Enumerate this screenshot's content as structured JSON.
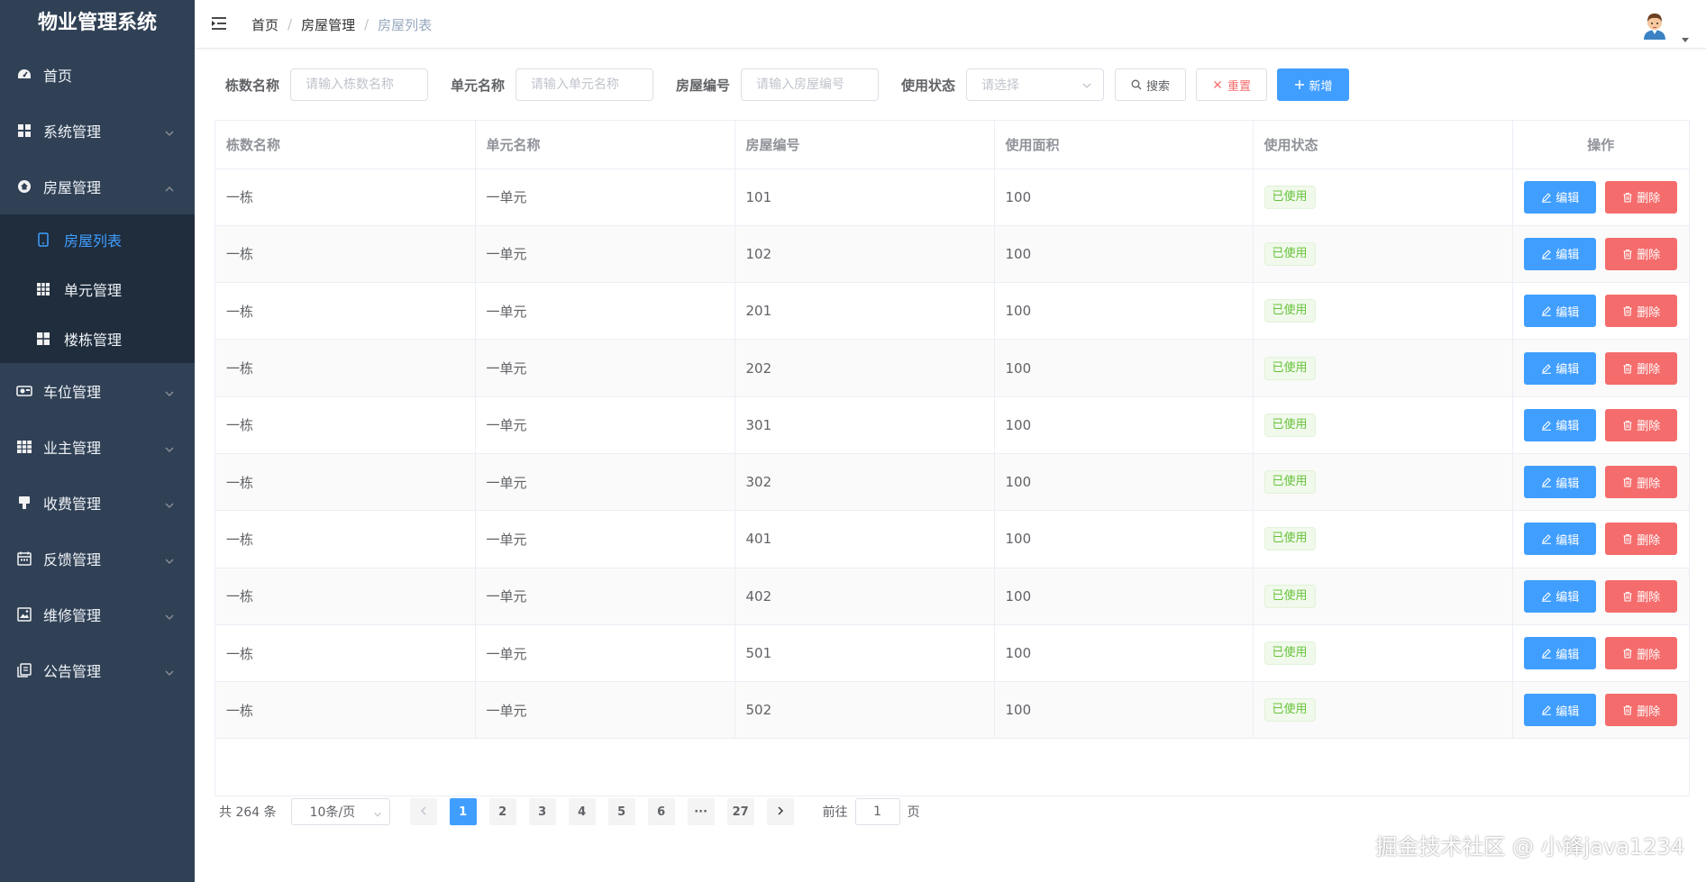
{
  "app": {
    "title": "物业管理系统"
  },
  "sidebar": {
    "items": [
      {
        "label": "首页",
        "icon": "dashboard-icon",
        "has_children": false
      },
      {
        "label": "系统管理",
        "icon": "grid-icon",
        "has_children": true,
        "expanded": false
      },
      {
        "label": "房屋管理",
        "icon": "house-icon",
        "has_children": true,
        "expanded": true
      },
      {
        "label": "车位管理",
        "icon": "car-icon",
        "has_children": true,
        "expanded": false
      },
      {
        "label": "业主管理",
        "icon": "table-icon",
        "has_children": true,
        "expanded": false
      },
      {
        "label": "收费管理",
        "icon": "brush-icon",
        "has_children": true,
        "expanded": false
      },
      {
        "label": "反馈管理",
        "icon": "calendar-icon",
        "has_children": true,
        "expanded": false
      },
      {
        "label": "维修管理",
        "icon": "picture-icon",
        "has_children": true,
        "expanded": false
      },
      {
        "label": "公告管理",
        "icon": "document-icon",
        "has_children": true,
        "expanded": false
      }
    ],
    "sub_items": [
      {
        "label": "房屋列表",
        "icon": "phone-icon",
        "active": true
      },
      {
        "label": "单元管理",
        "icon": "grid-icon",
        "active": false
      },
      {
        "label": "楼栋管理",
        "icon": "grid-icon",
        "active": false
      }
    ]
  },
  "header": {
    "breadcrumb": [
      "首页",
      "房屋管理",
      "房屋列表"
    ]
  },
  "search": {
    "building_label": "栋数名称",
    "building_placeholder": "请输入栋数名称",
    "unit_label": "单元名称",
    "unit_placeholder": "请输入单元名称",
    "house_label": "房屋编号",
    "house_placeholder": "请输入房屋编号",
    "status_label": "使用状态",
    "status_placeholder": "请选择",
    "search_button": "搜索",
    "reset_button": "重置",
    "add_button": "新增"
  },
  "table": {
    "columns": [
      "栋数名称",
      "单元名称",
      "房屋编号",
      "使用面积",
      "使用状态",
      "操作"
    ],
    "edit_label": "编辑",
    "delete_label": "删除",
    "rows": [
      {
        "building": "一栋",
        "unit": "一单元",
        "house": "101",
        "area": "100",
        "status": "已使用"
      },
      {
        "building": "一栋",
        "unit": "一单元",
        "house": "102",
        "area": "100",
        "status": "已使用"
      },
      {
        "building": "一栋",
        "unit": "一单元",
        "house": "201",
        "area": "100",
        "status": "已使用"
      },
      {
        "building": "一栋",
        "unit": "一单元",
        "house": "202",
        "area": "100",
        "status": "已使用"
      },
      {
        "building": "一栋",
        "unit": "一单元",
        "house": "301",
        "area": "100",
        "status": "已使用"
      },
      {
        "building": "一栋",
        "unit": "一单元",
        "house": "302",
        "area": "100",
        "status": "已使用"
      },
      {
        "building": "一栋",
        "unit": "一单元",
        "house": "401",
        "area": "100",
        "status": "已使用"
      },
      {
        "building": "一栋",
        "unit": "一单元",
        "house": "402",
        "area": "100",
        "status": "已使用"
      },
      {
        "building": "一栋",
        "unit": "一单元",
        "house": "501",
        "area": "100",
        "status": "已使用"
      },
      {
        "building": "一栋",
        "unit": "一单元",
        "house": "502",
        "area": "100",
        "status": "已使用"
      }
    ]
  },
  "pagination": {
    "total_text": "共 264 条",
    "page_size": "10条/页",
    "pages": [
      "1",
      "2",
      "3",
      "4",
      "5",
      "6",
      "···",
      "27"
    ],
    "current_page": "1",
    "goto_prefix": "前往",
    "goto_value": "1",
    "goto_suffix": "页"
  },
  "watermark": "掘金技术社区 @ 小锋java1234",
  "colors": {
    "sidebar_bg": "#304156",
    "submenu_bg": "#1f2d3d",
    "primary": "#409eff",
    "danger": "#f56c6c",
    "success": "#67c23a"
  }
}
